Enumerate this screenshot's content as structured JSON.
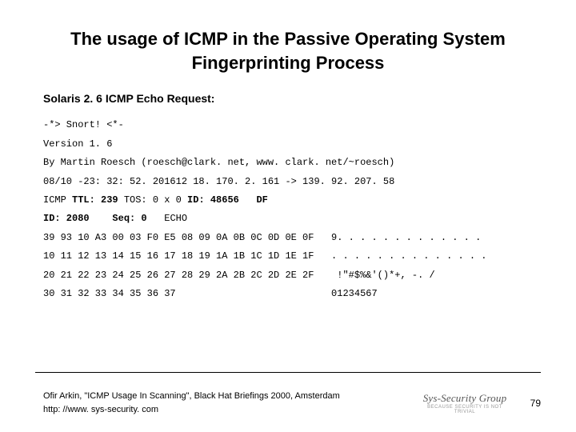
{
  "title": "The usage of ICMP in the Passive Operating System Fingerprinting Process",
  "subhead": "Solaris 2. 6 ICMP Echo Request:",
  "lines": {
    "l1": "-*> Snort! <*-",
    "l2": "Version 1. 6",
    "l3": "By Martin Roesch (roesch@clark. net, www. clark. net/~roesch)",
    "l4_pre": "08/10 -23: 32: 52. 201612 18. 170. 2. 161 -> 139. 92. 207. 58",
    "l5_a": "ICMP ",
    "l5_ttl": "TTL: 239",
    "l5_b": " TOS: 0 x 0 ",
    "l5_id": "ID: 48656",
    "l5_c": "   ",
    "l5_df": "DF",
    "l6_id": "ID: 2080",
    "l6_sp1": "    ",
    "l6_seq": "Seq: 0",
    "l6_sp2": "   ECHO",
    "h1": "39 93 10 A3 00 03 F0 E5 08 09 0A 0B 0C 0D 0E 0F   9. . . . . . . . . . . . .",
    "h2": "10 11 12 13 14 15 16 17 18 19 1A 1B 1C 1D 1E 1F   . . . . . . . . . . . . . .",
    "h3": "20 21 22 23 24 25 26 27 28 29 2A 2B 2C 2D 2E 2F    !\"#$%&'()*+, -. /",
    "h4": "30 31 32 33 34 35 36 37                           01234567"
  },
  "footer": {
    "ref1": "Ofir Arkin, \"ICMP Usage In Scanning\", Black Hat Briefings 2000, Amsterdam",
    "ref2": "http: //www. sys-security. com",
    "logo_brand": "Sys-Security Group",
    "logo_tag": "BECAUSE SECURITY IS NOT TRIVIAL",
    "page": "79"
  }
}
